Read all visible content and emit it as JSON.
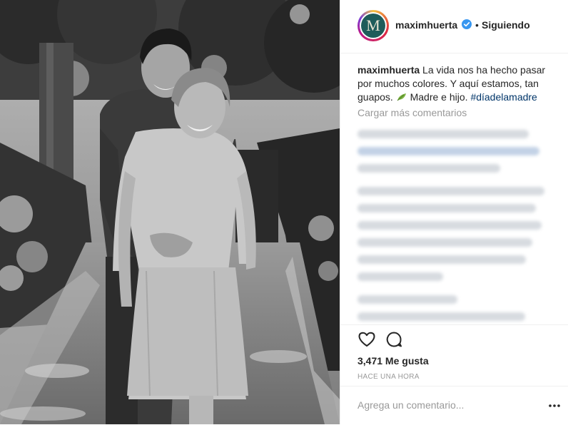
{
  "post": {
    "username": "maximhuerta",
    "avatar_letter": "M",
    "follow_separator": "•",
    "follow_status": "Siguiendo",
    "caption_user": "maximhuerta",
    "caption_text": "La vida nos ha hecho pasar por muchos colores. Y aquí estamos, tan guapos.",
    "caption_tail": "Madre e hijo.",
    "hashtag": "#díadelamadre",
    "load_more": "Cargar más comentarios",
    "likes": "3,471 Me gusta",
    "time": "HACE UNA HORA",
    "comment_placeholder": "Agrega un comentario...",
    "more_label": "•••"
  },
  "icons": {
    "verified": "verified-badge-icon",
    "leaf": "leaf-emoji-icon",
    "heart": "heart-outline-icon",
    "comment": "comment-bubble-icon",
    "more": "more-options-icon"
  },
  "colors": {
    "verified": "#3897f0",
    "hashtag": "#003569",
    "muted": "#999999",
    "text": "#262626"
  }
}
